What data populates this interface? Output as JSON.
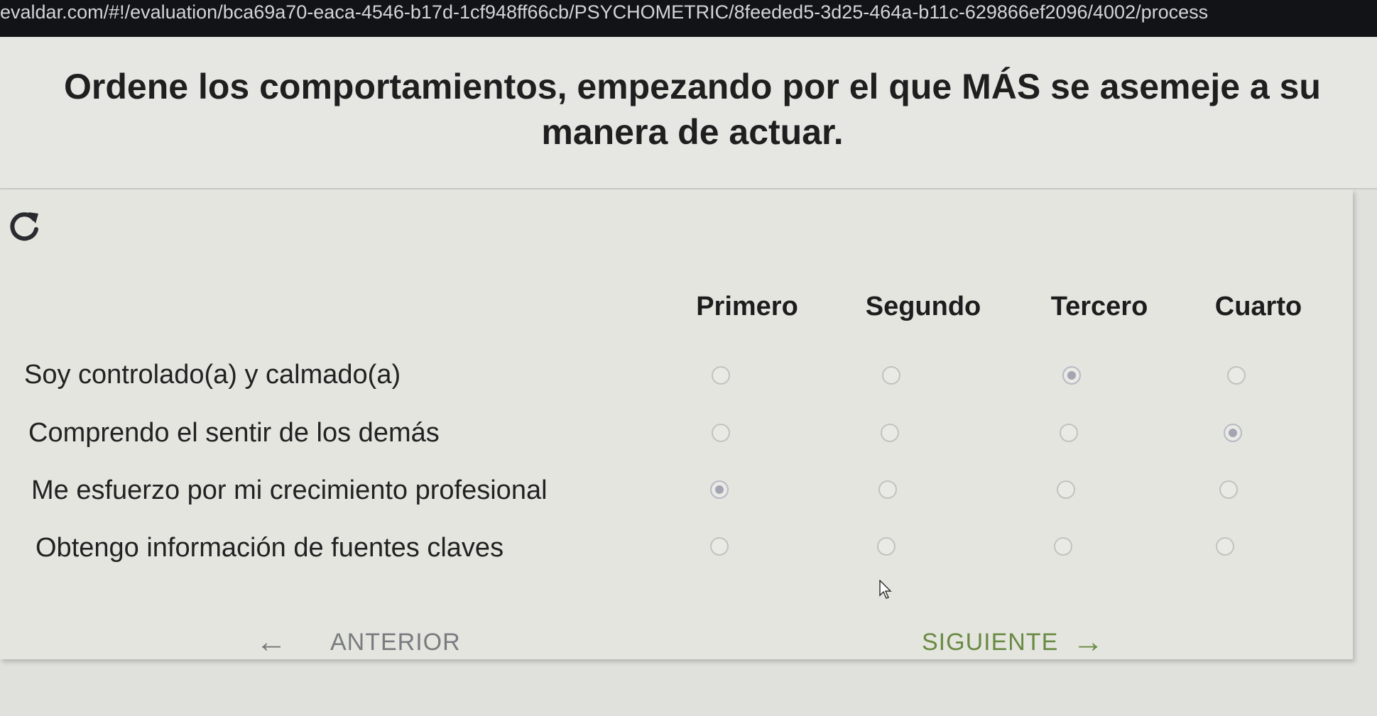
{
  "browser": {
    "url": "evaldar.com/#!/evaluation/bca69a70-eaca-4546-b17d-1cf948ff66cb/PSYCHOMETRIC/8feeded5-3d25-464a-b11c-629866ef2096/4002/process"
  },
  "question": {
    "title": "Ordene los comportamientos, empezando por el que MÁS se asemeje a su manera de actuar."
  },
  "columns": [
    "Primero",
    "Segundo",
    "Tercero",
    "Cuarto"
  ],
  "rows": [
    {
      "label": "Soy controlado(a) y calmado(a)",
      "selected": "Tercero"
    },
    {
      "label": "Comprendo el sentir de los demás",
      "selected": "Cuarto"
    },
    {
      "label": "Me esfuerzo por mi crecimiento profesional",
      "selected": "Primero"
    },
    {
      "label": "Obtengo información de fuentes claves",
      "selected": null
    }
  ],
  "navigation": {
    "prev_label": "ANTERIOR",
    "next_label": "SIGUIENTE"
  },
  "icons": {
    "refresh": "refresh-icon",
    "prev_arrow": "arrow-left-icon",
    "next_arrow": "arrow-right-icon",
    "cursor": "mouse-cursor-icon"
  },
  "colors": {
    "next_accent": "#6a8a43",
    "selected_dot": "#a4a5b3"
  }
}
